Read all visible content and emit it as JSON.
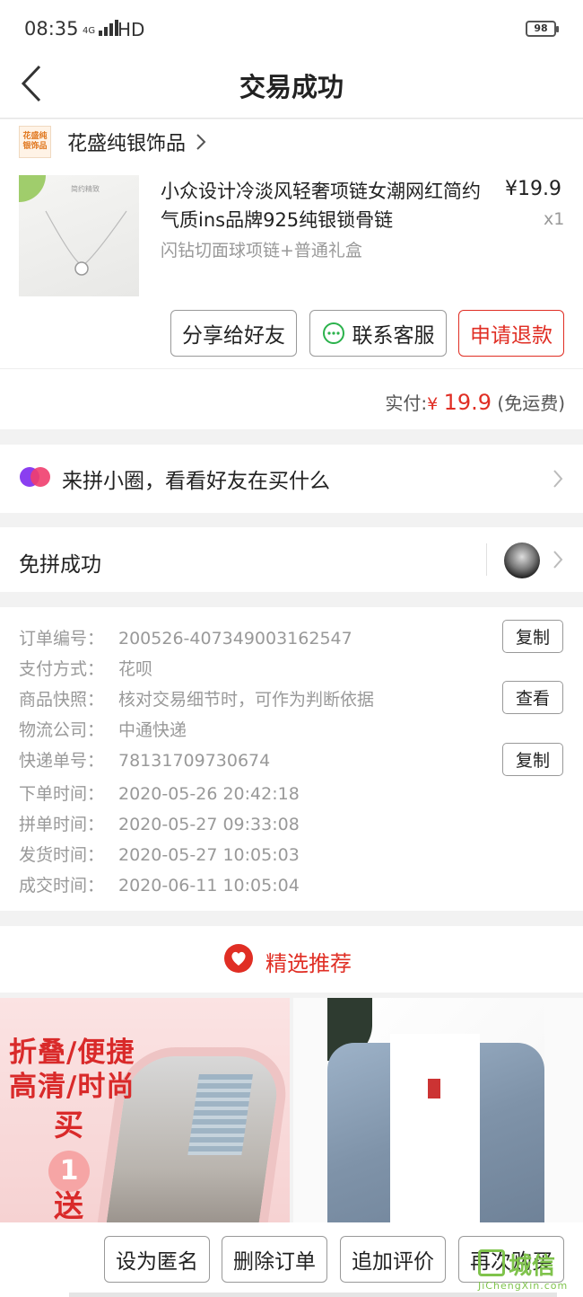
{
  "status_bar": {
    "time": "08:35",
    "network": "4G",
    "hd": "HD",
    "battery": "98"
  },
  "nav": {
    "title": "交易成功",
    "back_icon": "chevron-left-icon"
  },
  "shop": {
    "logo_text": "花盛纯银饰品",
    "name": "花盛纯银饰品"
  },
  "product": {
    "image_caption": "简约精致",
    "title": "小众设计冷淡风轻奢项链女潮网红简约气质ins品牌925纯银锁骨链",
    "sku": "闪钻切面球项链+普通礼盒",
    "price": "¥19.9",
    "quantity": "x1"
  },
  "actions": {
    "share": "分享给好友",
    "contact": "联系客服",
    "refund": "申请退款"
  },
  "total": {
    "label": "实付:",
    "currency": "¥",
    "amount": "19.9",
    "shipping": "(免运费)"
  },
  "circle": {
    "text": "来拼小圈，看看好友在买什么"
  },
  "group": {
    "text": "免拼成功"
  },
  "order_info": [
    {
      "key": "订单编号：",
      "value": "200526-407349003162547",
      "button": "复制"
    },
    {
      "key": "支付方式：",
      "value": "花呗"
    },
    {
      "key": "商品快照：",
      "value": "核对交易细节时，可作为判断依据",
      "button": "查看"
    },
    {
      "key": "物流公司：",
      "value": "中通快递"
    },
    {
      "key": "快递单号：",
      "value": "78131709730674",
      "button": "复制"
    },
    {
      "key": "下单时间：",
      "value": "2020-05-26 20:42:18"
    },
    {
      "key": "拼单时间：",
      "value": "2020-05-27 09:33:08"
    },
    {
      "key": "发货时间：",
      "value": "2020-05-27 10:05:03"
    },
    {
      "key": "成交时间：",
      "value": "2020-06-11 10:05:04"
    }
  ],
  "recommend": {
    "title": "精选推荐",
    "left_promo_line1": "折叠/便捷",
    "left_promo_line2": "高清/时尚",
    "left_promo_buy": "买",
    "left_promo_num": "1",
    "left_promo_send": "送"
  },
  "bottom_actions": {
    "anonymous": "设为匿名",
    "delete": "删除订单",
    "review": "追加评价",
    "rebuy": "再次购买"
  },
  "watermark": {
    "text": "城信",
    "sub": "JiChengXin.com"
  },
  "colors": {
    "accent": "#e02e24",
    "watermark": "#7fc34c"
  }
}
